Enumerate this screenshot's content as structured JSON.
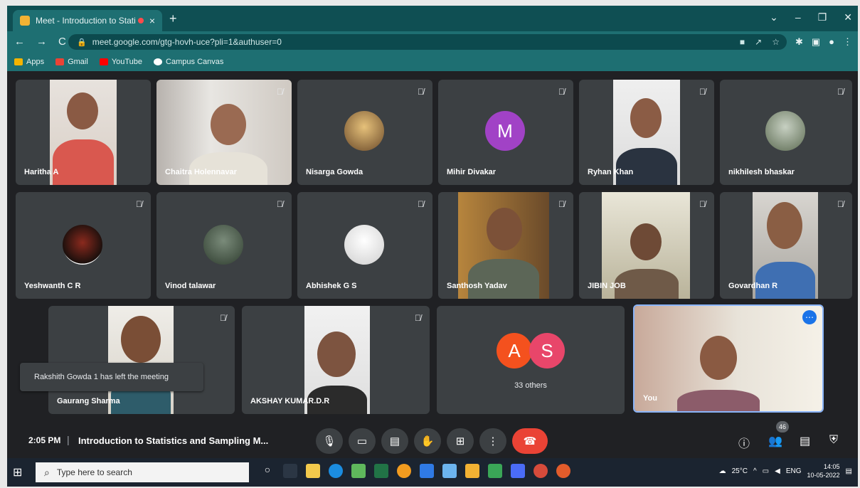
{
  "browser": {
    "tab_title": "Meet - Introduction to Stati",
    "tab_close": "×",
    "new_tab": "+",
    "url": "meet.google.com/gtg-hovh-uce?pli=1&authuser=0",
    "bookmarks": [
      "Apps",
      "Gmail",
      "YouTube",
      "Campus Canvas"
    ],
    "window_controls": [
      "⌄",
      "–",
      "❐",
      "✕"
    ]
  },
  "participants_row1": [
    {
      "name": "Haritha A"
    },
    {
      "name": "Chaitra Holennavar"
    },
    {
      "name": "Nisarga Gowda"
    },
    {
      "name": "Mihir Divakar",
      "initial": "M"
    },
    {
      "name": "Ryhan Khan"
    },
    {
      "name": "nikhilesh bhaskar"
    }
  ],
  "participants_row2": [
    {
      "name": "Yeshwanth C R"
    },
    {
      "name": "Vinod talawar"
    },
    {
      "name": "Abhishek G S"
    },
    {
      "name": "Santhosh Yadav"
    },
    {
      "name": "JIBIN JOB"
    },
    {
      "name": "Govardhan R"
    }
  ],
  "participants_row3": [
    {
      "name": "Gaurang Sharma"
    },
    {
      "name": "AKSHAY KUMAR.D.R"
    }
  ],
  "others_tile": {
    "initials": [
      "A",
      "S"
    ],
    "count_label": "33 others"
  },
  "self_tile": {
    "name": "You"
  },
  "toast": "Rakshith Gowda 1 has left the meeting",
  "meeting": {
    "time": "2:05 PM",
    "separator": "|",
    "title": "Introduction to Statistics and Sampling M...",
    "participant_count": "46"
  },
  "taskbar": {
    "search_placeholder": "Type here to search",
    "temperature": "25°C",
    "lang": "ENG",
    "clock_time": "14:05",
    "clock_date": "10-05-2022"
  },
  "colors": {
    "chrome_dark": "#0f4f53",
    "chrome_mid": "#1e6f72",
    "meet_bg": "#202124",
    "tile_bg": "#3c4043",
    "end_call": "#ea4335",
    "avatar_m": "#a142c6",
    "avatar_a": "#f4511e",
    "avatar_s": "#e8466a",
    "self_border": "#8ab4f8"
  }
}
